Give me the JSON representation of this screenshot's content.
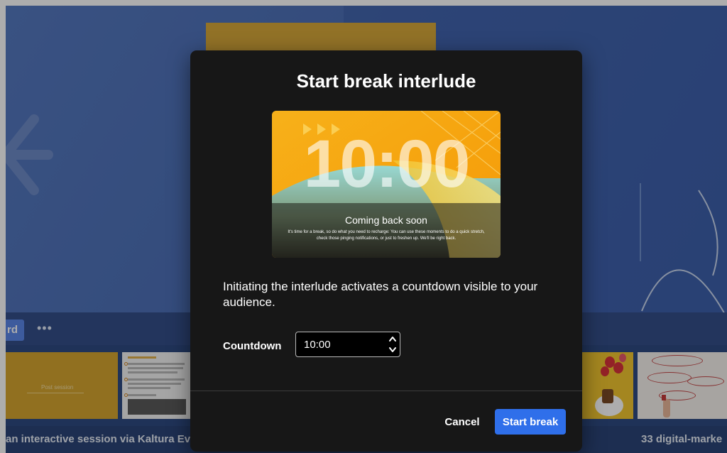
{
  "background": {
    "toolbar": {
      "active_label": "rd",
      "more_icon": "more-horizontal-icon"
    },
    "thumbnails": [
      {
        "text": "Post session"
      }
    ],
    "captions": {
      "left": "an interactive session via Kaltura Ev",
      "right": "33 digital-marke"
    }
  },
  "modal": {
    "title": "Start break interlude",
    "preview": {
      "time": "10:00",
      "heading": "Coming back soon",
      "body": "It's time for a break, so do what you need to recharge: You can use these moments to do a quick stretch, check those pinging notifications, or just to freshen up. We'll be right back."
    },
    "description": "Initiating the interlude activates a countdown visible to your audience.",
    "countdown": {
      "label": "Countdown",
      "value": "10:00"
    },
    "buttons": {
      "cancel": "Cancel",
      "start": "Start break"
    }
  },
  "colors": {
    "modal_bg": "#171717",
    "primary": "#2f6fea",
    "background_app": "#3f5fa6"
  }
}
